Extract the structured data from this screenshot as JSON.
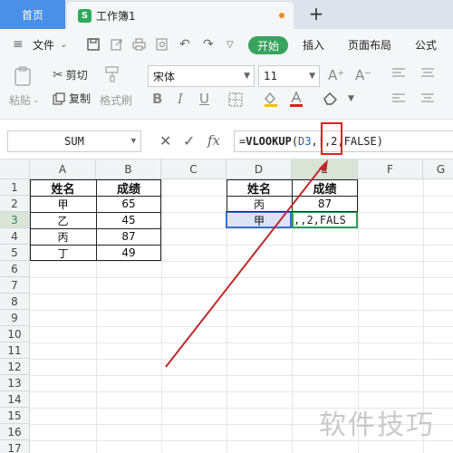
{
  "tabs": {
    "home": "首页",
    "document": "工作簿1",
    "doc_logo": "S",
    "new_tab": "+"
  },
  "menu": {
    "file": "文件",
    "start": "开始",
    "insert": "插入",
    "page_layout": "页面布局",
    "formulas": "公式"
  },
  "ribbon": {
    "paste": "粘贴",
    "cut": "剪切",
    "copy": "复制",
    "format_painter": "格式刷",
    "font_name": "宋体",
    "font_size": "11",
    "bold": "B",
    "italic": "I",
    "underline": "U",
    "grow": "A⁺",
    "shrink": "A⁻"
  },
  "formula_bar": {
    "name_box": "SUM",
    "fx": "fx",
    "formula_prefix": "=",
    "formula_fn": "VLOOKUP",
    "formula_open": "(",
    "formula_ref": "D3",
    "formula_rest": ",|,2,FALSE)"
  },
  "grid": {
    "columns": [
      "A",
      "B",
      "C",
      "D",
      "E",
      "F",
      "G"
    ],
    "selected_column": "E",
    "rows": [
      "1",
      "2",
      "3",
      "4",
      "5",
      "6",
      "7",
      "8",
      "9",
      "10",
      "11",
      "12",
      "13",
      "14",
      "15",
      "16",
      "17"
    ],
    "selected_row": "3",
    "table1": {
      "headers": [
        "姓名",
        "成绩"
      ],
      "rows": [
        [
          "甲",
          "65"
        ],
        [
          "乙",
          "45"
        ],
        [
          "丙",
          "87"
        ],
        [
          "丁",
          "49"
        ]
      ]
    },
    "table2": {
      "headers": [
        "姓名",
        "成绩"
      ],
      "row2": [
        "丙",
        "87"
      ],
      "d3": "甲",
      "e3_editing": ",,2,FALS"
    }
  },
  "watermark": "软件技巧",
  "colors": {
    "accent_green": "#37a35e",
    "home_blue": "#4a8fe8",
    "highlight_red": "#e02020",
    "select_blue": "#3b6fd4"
  }
}
